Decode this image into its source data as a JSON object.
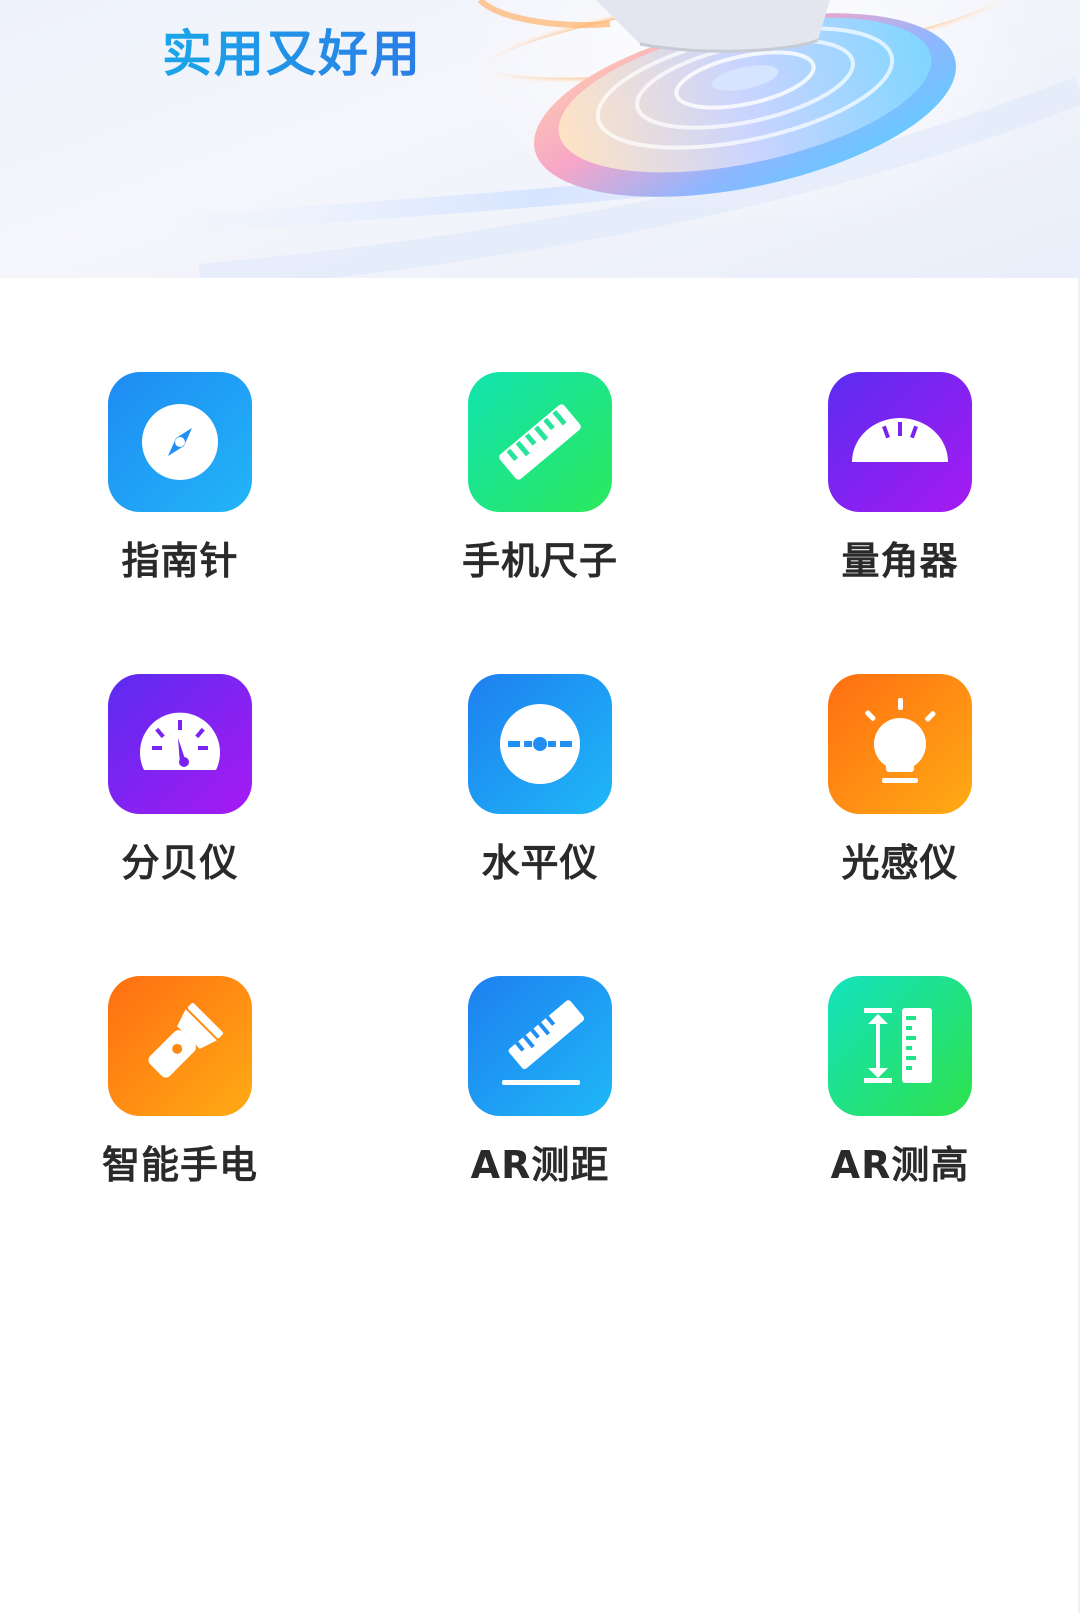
{
  "banner": {
    "title": "实用又好用"
  },
  "tools": [
    {
      "label": "指南针",
      "icon": "compass-icon"
    },
    {
      "label": "手机尺子",
      "icon": "ruler-icon"
    },
    {
      "label": "量角器",
      "icon": "protractor-icon"
    },
    {
      "label": "分贝仪",
      "icon": "decibel-meter-icon"
    },
    {
      "label": "水平仪",
      "icon": "level-icon"
    },
    {
      "label": "光感仪",
      "icon": "light-sensor-icon"
    },
    {
      "label": "智能手电",
      "icon": "flashlight-icon"
    },
    {
      "label": "AR测距",
      "icon": "ar-distance-icon"
    },
    {
      "label": "AR测高",
      "icon": "ar-height-icon"
    }
  ],
  "colors": {
    "title_blue": "#1e8ee8",
    "label_text": "#2a2a2a",
    "blue": "#1e8bf3",
    "green": "#2be85c",
    "purple": "#7a22f1",
    "orange": "#ff8a12"
  }
}
